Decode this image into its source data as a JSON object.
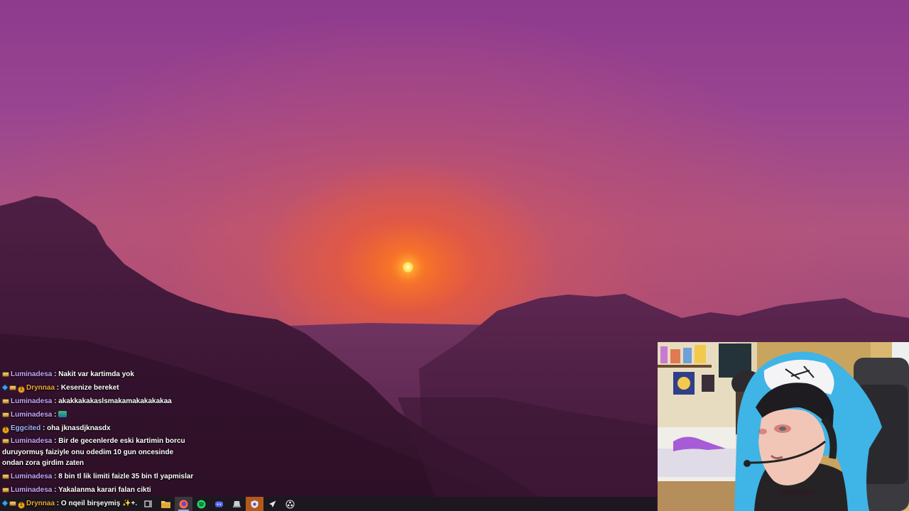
{
  "chat": {
    "messages": [
      {
        "user": "Luminadesa",
        "sep": " : ",
        "text": "Nakit var kartimda yok"
      },
      {
        "user": "Drynnaa",
        "sep": " : ",
        "text": "Kesenize bereket"
      },
      {
        "user": "Luminadesa",
        "sep": " : ",
        "text": "akakkakakaslsmakamakakakakaa"
      },
      {
        "user": "Luminadesa",
        "sep": " : ",
        "text": ""
      },
      {
        "user": "Eggcited",
        "sep": " : ",
        "text": "oha jknasdjknasdx"
      },
      {
        "user": "Luminadesa",
        "sep": " : ",
        "text": "Bir de gecenlerde eski kartimin borcu duruyormuş faiziyle onu odedim 10 gun oncesinde ondan zora girdim zaten"
      },
      {
        "user": "Luminadesa",
        "sep": " : ",
        "text": "8 bin tl lik limiti faizle 35 bin tl yapmislar"
      },
      {
        "user": "Luminadesa",
        "sep": " : ",
        "text": "Yakalanma karari falan cikti"
      }
    ],
    "last_message": {
      "user": "Drynnaa",
      "sep": " : ",
      "text": "O nqeil birşeymiş ✨+."
    }
  },
  "taskbar": {
    "icons": [
      "task-view-icon",
      "file-explorer-icon",
      "firefox-icon",
      "spotify-icon",
      "discord-icon",
      "app-icon",
      "streaming-app-icon",
      "steam-icon",
      "obs-icon"
    ]
  },
  "colors": {
    "username_purple": "#c9a7ff",
    "username_orange": "#f2a93b",
    "username_blue": "#9fb8ff",
    "taskbar_bg": "#1c1820"
  }
}
